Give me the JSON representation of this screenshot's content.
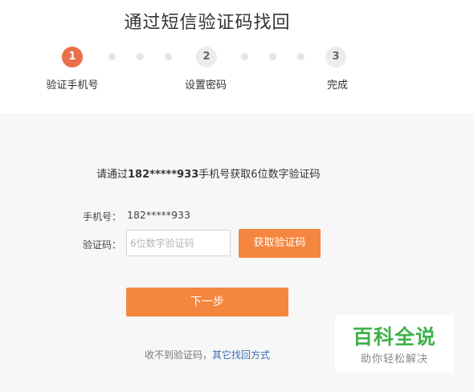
{
  "page": {
    "title": "通过短信验证码找回"
  },
  "steps": [
    {
      "number": "1",
      "label": "验证手机号",
      "state": "active"
    },
    {
      "number": "2",
      "label": "设置密码",
      "state": "inactive"
    },
    {
      "number": "3",
      "label": "完成",
      "state": "inactive"
    }
  ],
  "form": {
    "instruction_prefix": "请通过",
    "instruction_phone": "182*****933",
    "instruction_suffix": "手机号获取6位数字验证码",
    "phone_label": "手机号：",
    "phone_value": "182*****933",
    "code_label": "验证码：",
    "code_placeholder": "6位数字验证码",
    "code_value": "",
    "get_code_button": "获取验证码",
    "next_button": "下一步"
  },
  "footer": {
    "no_code_text": "收不到验证码，",
    "other_methods_link": "其它找回方式"
  },
  "watermark": {
    "title": "百科全说",
    "subtitle": "助你轻松解决"
  },
  "colors": {
    "accent": "#f5863f",
    "active_step": "#e8704a",
    "link": "#3d6db3",
    "watermark_green": "#3fb24a"
  }
}
